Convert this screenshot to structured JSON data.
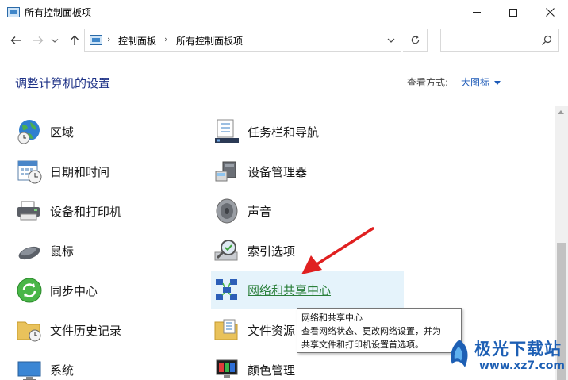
{
  "window": {
    "title": "所有控制面板项"
  },
  "address": {
    "crumbs": [
      "控制面板",
      "所有控制面板项"
    ],
    "search_placeholder": ""
  },
  "header": {
    "title": "调整计算机的设置",
    "view_by_label": "查看方式:",
    "view_by_value": "大图标"
  },
  "items": {
    "left": [
      {
        "label": "区域",
        "icon": "globe-clock-icon"
      },
      {
        "label": "日期和时间",
        "icon": "calendar-clock-icon"
      },
      {
        "label": "设备和打印机",
        "icon": "printer-icon"
      },
      {
        "label": "鼠标",
        "icon": "mouse-icon"
      },
      {
        "label": "同步中心",
        "icon": "sync-icon"
      },
      {
        "label": "文件历史记录",
        "icon": "folder-clock-icon"
      },
      {
        "label": "系统",
        "icon": "computer-icon"
      }
    ],
    "right": [
      {
        "label": "任务栏和导航",
        "icon": "taskbar-icon"
      },
      {
        "label": "设备管理器",
        "icon": "device-manager-icon"
      },
      {
        "label": "声音",
        "icon": "speaker-icon"
      },
      {
        "label": "索引选项",
        "icon": "indexing-icon"
      },
      {
        "label": "网络和共享中心",
        "icon": "network-icon"
      },
      {
        "label": "文件资源",
        "icon": "explorer-options-icon"
      },
      {
        "label": "颜色管理",
        "icon": "color-management-icon"
      }
    ]
  },
  "tooltip": {
    "title": "网络和共享中心",
    "line1": "查看网络状态、更改网络设置，并为",
    "line2": "共享文件和打印机设置首选项。"
  },
  "watermark": {
    "brand": "极光下载站",
    "url": "www.xz7.com"
  },
  "colors": {
    "heading": "#1e3287",
    "link": "#1e5bb8",
    "hover_bg": "#e5f3fb",
    "hover_text": "#2a7f3a",
    "arrow": "#e02020"
  }
}
